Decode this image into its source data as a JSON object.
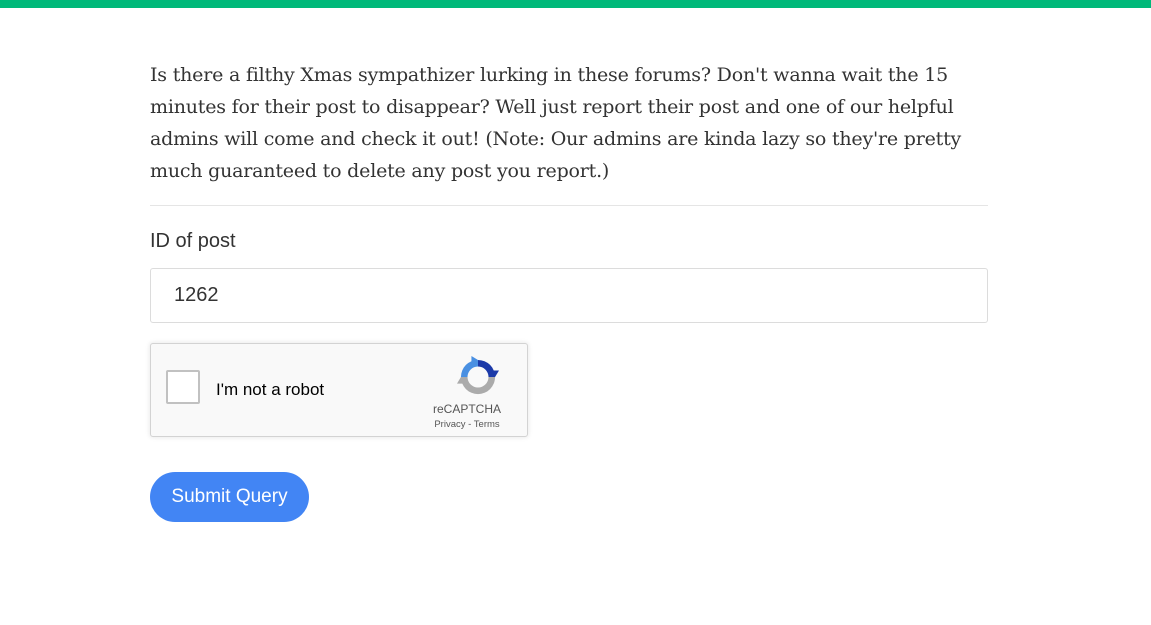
{
  "colors": {
    "top_bar": "#00b97a",
    "submit_button": "#4285f4",
    "text": "#333333"
  },
  "intro": {
    "text": "Is there a filthy Xmas sympathizer lurking in these forums? Don't wanna wait the 15 minutes for their post to disappear? Well just report their post and one of our helpful admins will come and check it out! (Note: Our admins are kinda lazy so they're pretty much guaranteed to delete any post you report.)"
  },
  "form": {
    "post_id_label": "ID of post",
    "post_id_value": "1262",
    "submit_label": "Submit Query"
  },
  "recaptcha": {
    "checkbox_label": "I'm not a robot",
    "brand": "reCAPTCHA",
    "privacy": "Privacy",
    "separator": " - ",
    "terms": "Terms",
    "logo_icon": "recaptcha-logo-icon"
  }
}
